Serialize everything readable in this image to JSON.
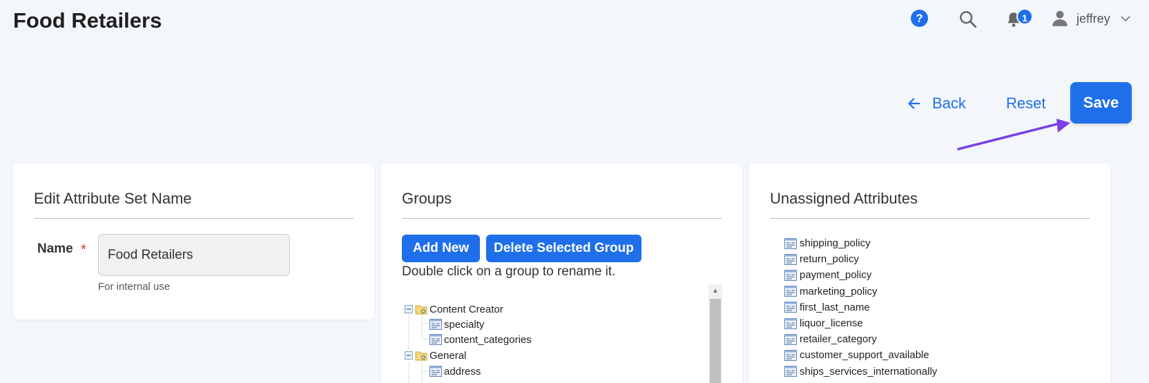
{
  "page": {
    "title": "Food Retailers"
  },
  "header": {
    "help_glyph": "?",
    "notification_count": "1",
    "user_name": "jeffrey"
  },
  "actions": {
    "back_label": "Back",
    "reset_label": "Reset",
    "save_label": "Save"
  },
  "edit_panel": {
    "title": "Edit Attribute Set Name",
    "name_label": "Name",
    "required_mark": "*",
    "name_value": "Food Retailers",
    "hint": "For internal use"
  },
  "groups_panel": {
    "title": "Groups",
    "add_new_label": "Add New",
    "delete_label": "Delete Selected Group",
    "hint": "Double click on a group to rename it.",
    "tree": [
      {
        "label": "Content Creator",
        "children": [
          "specialty",
          "content_categories"
        ]
      },
      {
        "label": "General",
        "children": [
          "address"
        ]
      }
    ]
  },
  "unassigned_panel": {
    "title": "Unassigned Attributes",
    "attributes": [
      "shipping_policy",
      "return_policy",
      "payment_policy",
      "marketing_policy",
      "first_last_name",
      "liquor_license",
      "retailer_category",
      "customer_support_available",
      "ships_services_internationally"
    ]
  },
  "colors": {
    "accent": "#1f6feb",
    "annotation_arrow": "#7b3fe4",
    "required": "#d32f2f",
    "background": "#f3f6fb"
  },
  "icons": {
    "help": "help-circle-icon",
    "search": "search-icon",
    "notifications": "bell-icon",
    "user": "user-icon",
    "menu": "chevron-down-icon",
    "back": "arrow-left-icon",
    "attribute": "attribute-icon",
    "group": "folder-icon"
  }
}
